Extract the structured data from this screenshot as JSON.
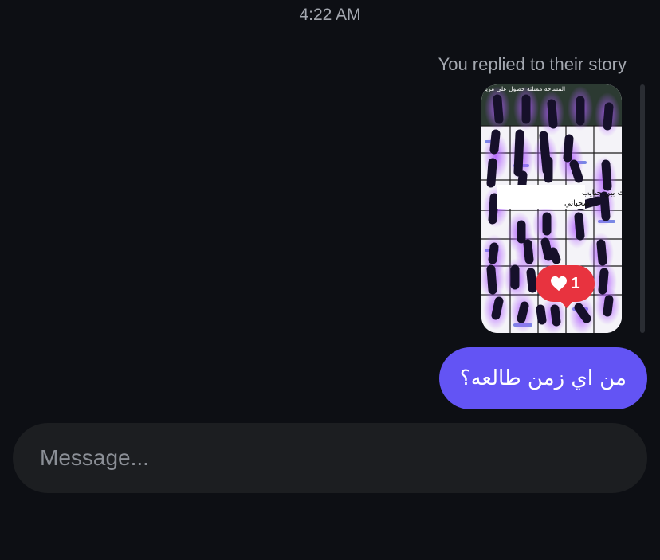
{
  "conversation": {
    "timestamp": "4:22 AM",
    "reply_note": "You replied to their story"
  },
  "story": {
    "top_text": "المساحة ممتلئة  حصول على مزيد",
    "caption_line1": "أنا الطرف الثالث بين حبايب",
    "caption_line2": "صحباتي",
    "like_count": "1",
    "like_color": "#e8333f"
  },
  "message": {
    "text": "من اي زمن طالعه؟",
    "bubble_color": "#6354f4"
  },
  "composer": {
    "placeholder": "Message..."
  }
}
